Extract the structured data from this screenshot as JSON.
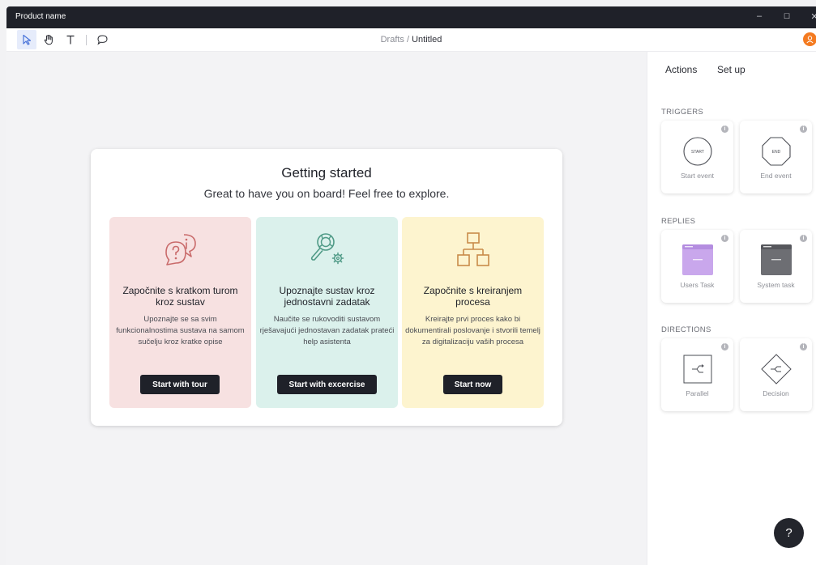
{
  "window": {
    "title": "Product name",
    "controls": {
      "minimize": "–",
      "maximize": "☐",
      "close": "✕"
    }
  },
  "toolbar": {
    "tools": [
      "pointer-icon",
      "hand-icon",
      "text-icon",
      "comment-icon"
    ],
    "breadcrumb": {
      "parent": "Drafts",
      "separator": " / ",
      "current": "Untitled"
    }
  },
  "getting_started": {
    "title": "Getting started",
    "subtitle": "Great to have you on board! Feel free to explore.",
    "options": [
      {
        "icon": "help-chat-icon",
        "bg": "#f7e1e1",
        "icon_color": "#c96b6b",
        "title": "Započnite s kratkom turom kroz sustav",
        "description": "Upoznajte se sa svim funkcionalnostima sustava na samom sučelju kroz kratke opise",
        "button": "Start with tour"
      },
      {
        "icon": "search-gear-icon",
        "bg": "#dbf1ec",
        "icon_color": "#4f9a86",
        "title": "Upoznajte sustav kroz jednostavni zadatak",
        "description": "Naučite se rukovoditi sustavom rješavajući jednostavan zadatak prateći help asistenta",
        "button": "Start with excercise"
      },
      {
        "icon": "hierarchy-icon",
        "bg": "#fdf4cf",
        "icon_color": "#c98b4a",
        "title": "Započnite s kreiranjem procesa",
        "description": "Kreirajte prvi proces kako bi dokumentirali poslovanje i stvorili temelj za digitalizaciju vaših procesa",
        "button": "Start now"
      }
    ]
  },
  "panel": {
    "tabs": [
      "Actions",
      "Set up"
    ],
    "sections": [
      {
        "title": "TRIGGERS",
        "tiles": [
          {
            "label": "Start event",
            "icon": "start-circle-icon",
            "text": "START"
          },
          {
            "label": "End event",
            "icon": "end-octagon-icon",
            "text": "END"
          }
        ]
      },
      {
        "title": "REPLIES",
        "tiles": [
          {
            "label": "Users Task",
            "icon": "user-task-card-icon",
            "color": "#c9a7ec"
          },
          {
            "label": "System task",
            "icon": "system-task-card-icon",
            "color": "#6d6e73"
          }
        ]
      },
      {
        "title": "DIRECTIONS",
        "tiles": [
          {
            "label": "Parallel",
            "icon": "parallel-gateway-icon"
          },
          {
            "label": "Decision",
            "icon": "decision-diamond-icon"
          }
        ]
      }
    ],
    "info_glyph": "i"
  },
  "help": {
    "label": "?"
  }
}
